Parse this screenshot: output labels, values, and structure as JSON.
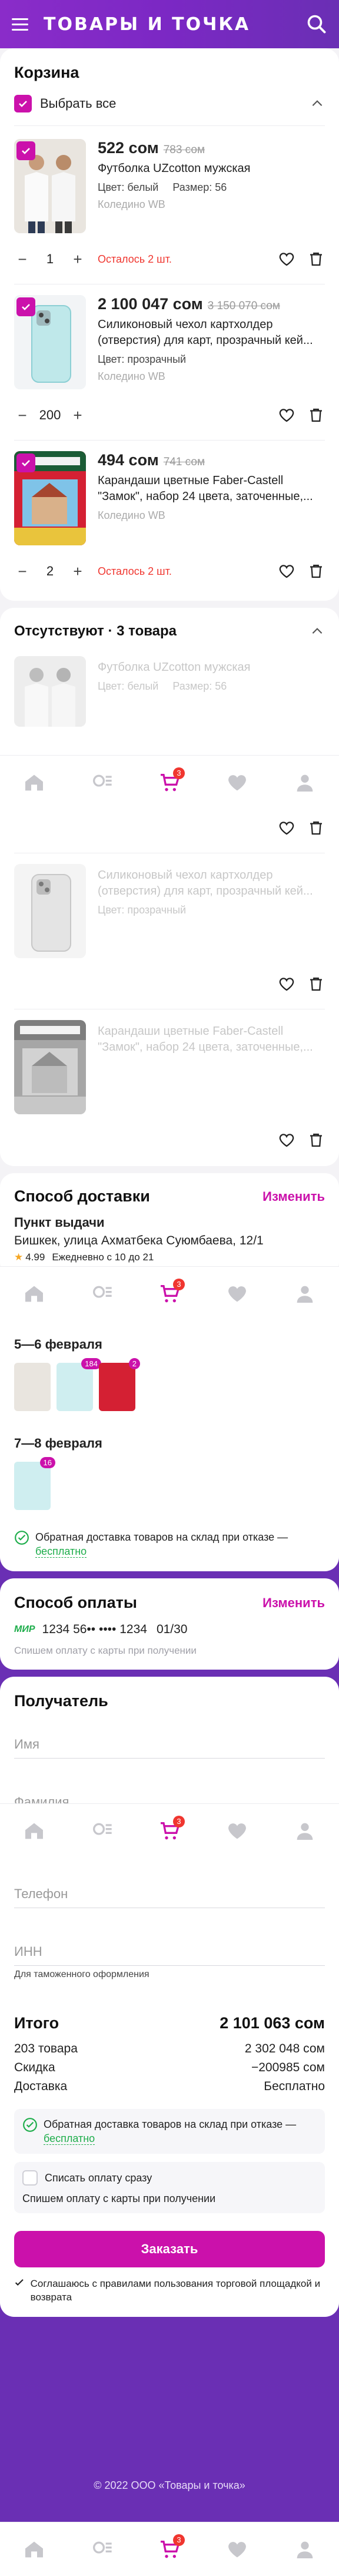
{
  "header": {
    "brand": "ТОВАРЫ И ТОЧКА"
  },
  "cart": {
    "title": "Корзина",
    "select_all": "Выбрать все",
    "currency": "сом",
    "items": [
      {
        "price": "522 сом",
        "old_price": "783 сом",
        "name": "Футболка UZcotton мужская",
        "color": "Цвет: белый",
        "size": "Размер: 56",
        "seller": "Коледино WB",
        "qty": "1",
        "left": "Осталось 2 шт."
      },
      {
        "price": "2 100 047 сом",
        "old_price": "3 150 070 сом",
        "name": "Силиконовый чехол картхолдер (отверстия) для карт, прозрачный кей...",
        "color": "Цвет: прозрачный",
        "seller": "Коледино WB",
        "qty": "200",
        "left": ""
      },
      {
        "price": "494 сом",
        "old_price": "741 сом",
        "name": "Карандаши цветные Faber-Castell \"Замок\", набор 24 цвета, заточенные,...",
        "color": "",
        "seller": "Коледино WB",
        "qty": "2",
        "left": "Осталось 2 шт."
      }
    ]
  },
  "absent": {
    "title": "Отсутствуют · 3 товара",
    "items": [
      {
        "name": "Футболка UZcotton мужская",
        "color": "Цвет: белый",
        "size": "Размер: 56"
      },
      {
        "name": "Силиконовый чехол картхолдер (отверстия) для карт, прозрачный кей...",
        "color": "Цвет: прозрачный"
      },
      {
        "name": "Карандаши цветные Faber-Castell \"Замок\", набор 24 цвета, заточенные,..."
      }
    ]
  },
  "delivery": {
    "title": "Способ доставки",
    "change": "Изменить",
    "point_label": "Пункт выдачи",
    "address": "Бишкек, улица Ахматбека Суюмбаева, 12/1",
    "rating": "4.99",
    "hours": "Ежедневно с 10 до 21",
    "group1_date": "5—6 февраля",
    "group1_badges": [
      "184",
      "2"
    ],
    "group2_date": "7—8 февраля",
    "group2_badges": [
      "16"
    ],
    "return_text": "Обратная доставка товаров на склад при отказе —",
    "return_free": "бесплатно"
  },
  "payment": {
    "title": "Способ оплаты",
    "change": "Изменить",
    "card_brand": "МИР",
    "card": "1234 56•• •••• 1234",
    "exp": "01/30",
    "note": "Спишем оплату с карты при получении"
  },
  "recipient": {
    "title": "Получатель",
    "name_ph": "Имя",
    "surname_ph": "Фамилия",
    "phone_ph": "Телефон",
    "inn_ph": "ИНН",
    "inn_note": "Для таможенного оформления"
  },
  "summary": {
    "title": "Итого",
    "total": "2 101 063 сом",
    "items_label": "203 товара",
    "items_value": "2 302 048 сом",
    "discount_label": "Скидка",
    "discount_value": "−200985 сом",
    "delivery_label": "Доставка",
    "delivery_value": "Бесплатно",
    "return_text": "Обратная доставка товаров на склад при отказе —",
    "return_free": "бесплатно",
    "pay_now": "Списать оплату сразу",
    "pay_note": "Спишем оплату с карты при получении",
    "order_button": "Заказать",
    "agree": "Соглашаюсь с правилами пользования торговой площадкой и возврата"
  },
  "nav": {
    "cart_badge": "3"
  },
  "footer": {
    "copyright": "© 2022 ООО «Товары и точка»"
  },
  "colors": {
    "brand": "#cb11ab",
    "header": "#7b28c4",
    "alert": "#f0362f",
    "green": "#1ead4b"
  }
}
